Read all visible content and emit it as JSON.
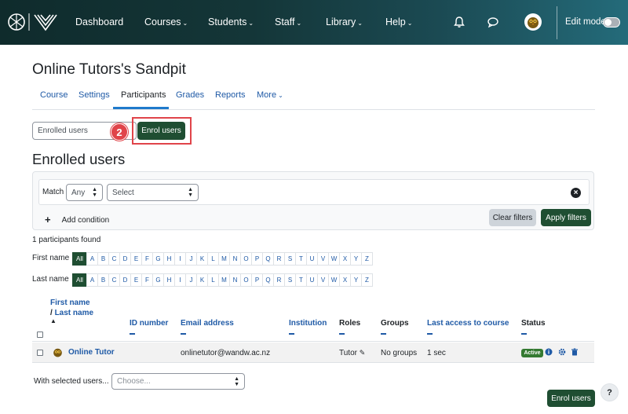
{
  "nav": {
    "items": [
      {
        "label": "Dashboard",
        "has_menu": false
      },
      {
        "label": "Courses",
        "has_menu": true
      },
      {
        "label": "Students",
        "has_menu": true
      },
      {
        "label": "Staff",
        "has_menu": true
      },
      {
        "label": "Library",
        "has_menu": true
      },
      {
        "label": "Help",
        "has_menu": true
      }
    ],
    "edit_mode_label": "Edit mode",
    "edit_mode_on": false
  },
  "course": {
    "title": "Online Tutors's Sandpit",
    "tabs": [
      {
        "label": "Course",
        "active": false
      },
      {
        "label": "Settings",
        "active": false
      },
      {
        "label": "Participants",
        "active": true
      },
      {
        "label": "Grades",
        "active": false
      },
      {
        "label": "Reports",
        "active": false
      },
      {
        "label": "More",
        "active": false,
        "has_menu": true
      }
    ]
  },
  "toolbar": {
    "view_select_value": "Enrolled users",
    "enrol_button_label": "Enrol users",
    "step_badge": "2"
  },
  "heading": "Enrolled users",
  "filter": {
    "match_label": "Match",
    "match_value": "Any",
    "type_value": "Select",
    "add_condition_label": "Add condition",
    "clear_label": "Clear filters",
    "apply_label": "Apply filters"
  },
  "participants_found": "1 participants found",
  "initials": {
    "first_name_label": "First name",
    "last_name_label": "Last name",
    "all_label": "All",
    "letters": [
      "A",
      "B",
      "C",
      "D",
      "E",
      "F",
      "G",
      "H",
      "I",
      "J",
      "K",
      "L",
      "M",
      "N",
      "O",
      "P",
      "Q",
      "R",
      "S",
      "T",
      "U",
      "V",
      "W",
      "X",
      "Y",
      "Z"
    ]
  },
  "table": {
    "headers": {
      "first_name": "First name",
      "separator": "/",
      "last_name": "Last name",
      "id_number": "ID number",
      "email": "Email address",
      "institution": "Institution",
      "roles": "Roles",
      "groups": "Groups",
      "last_access": "Last access to course",
      "status": "Status"
    },
    "rows": [
      {
        "name": "Online Tutor",
        "email": "onlinetutor@wandw.ac.nz",
        "role": "Tutor",
        "groups": "No groups",
        "last_access": "1 sec",
        "status": "Active"
      }
    ]
  },
  "bulk": {
    "label": "With selected users...",
    "placeholder": "Choose..."
  },
  "footer_enrol_label": "Enrol users",
  "help_label": "?",
  "colors": {
    "brand_green": "#1f4e32",
    "link_blue": "#1f5aa6",
    "highlight_red": "#e0444a",
    "active_badge": "#357a32"
  }
}
